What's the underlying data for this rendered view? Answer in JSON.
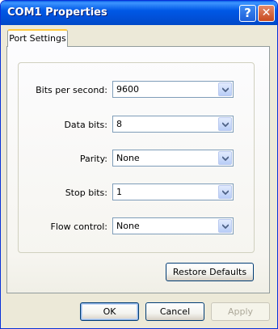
{
  "window": {
    "title": "COM1 Properties",
    "help_glyph": "?",
    "close_glyph": "✕"
  },
  "tabs": [
    {
      "label": "Port Settings",
      "selected": true
    }
  ],
  "fields": {
    "bits_per_second": {
      "label": "Bits per second:",
      "value": "9600"
    },
    "data_bits": {
      "label": "Data bits:",
      "value": "8"
    },
    "parity": {
      "label": "Parity:",
      "value": "None"
    },
    "stop_bits": {
      "label": "Stop bits:",
      "value": "1"
    },
    "flow_control": {
      "label": "Flow control:",
      "value": "None"
    }
  },
  "buttons": {
    "restore_defaults": "Restore Defaults",
    "ok": "OK",
    "cancel": "Cancel",
    "apply": "Apply"
  },
  "icons": {
    "help": "help-icon",
    "close": "close-icon",
    "combo_arrow": "chevron-down-icon"
  },
  "colors": {
    "titlebar": "#0058e6",
    "dialog_bg": "#ece9d8",
    "tab_highlight": "#ffc83c",
    "disabled_text": "#aca899"
  }
}
